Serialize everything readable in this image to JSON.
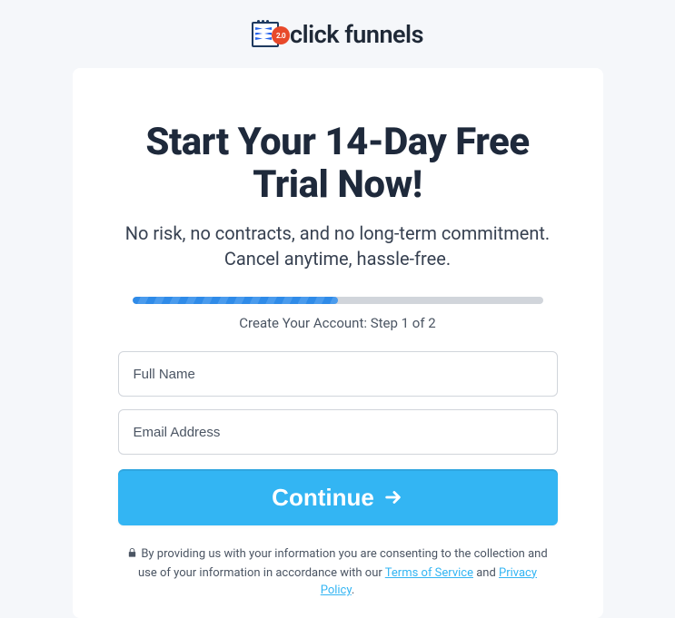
{
  "logo": {
    "text": "click funnels",
    "badge": "2.0"
  },
  "heading": "Start Your 14-Day Free Trial Now!",
  "subheading": "No risk, no contracts, and no long-term commitment. Cancel anytime, hassle-free.",
  "progress": {
    "percent": 50,
    "step_text": "Create Your Account: Step 1 of 2"
  },
  "form": {
    "full_name_placeholder": "Full Name",
    "email_placeholder": "Email Address",
    "continue_label": "Continue"
  },
  "consent": {
    "prefix": "By providing us with your information you are consenting to the collection and use of your information in accordance with our ",
    "tos_label": "Terms of Service",
    "separator": " and ",
    "privacy_label": "Privacy Policy",
    "suffix": "."
  }
}
